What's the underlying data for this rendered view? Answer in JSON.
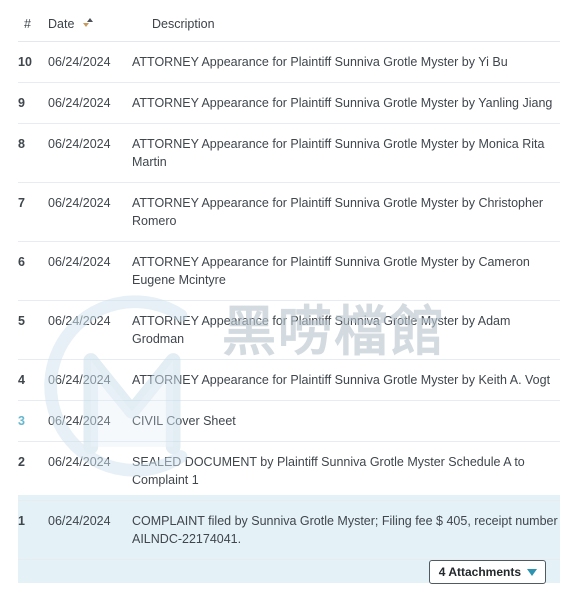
{
  "table": {
    "columns": [
      {
        "key": "num",
        "label": "#"
      },
      {
        "key": "date",
        "label": "Date",
        "sort_icon": "sort-ascending-icon"
      },
      {
        "key": "desc",
        "label": "Description"
      }
    ],
    "rows": [
      {
        "num": "10",
        "date": "06/24/2024",
        "desc": "ATTORNEY Appearance for Plaintiff Sunniva Grotle Myster by Yi Bu"
      },
      {
        "num": "9",
        "date": "06/24/2024",
        "desc": "ATTORNEY Appearance for Plaintiff Sunniva Grotle Myster by Yanling Jiang"
      },
      {
        "num": "8",
        "date": "06/24/2024",
        "desc": "ATTORNEY Appearance for Plaintiff Sunniva Grotle Myster by Monica Rita Martin"
      },
      {
        "num": "7",
        "date": "06/24/2024",
        "desc": "ATTORNEY Appearance for Plaintiff Sunniva Grotle Myster by Christopher Romero"
      },
      {
        "num": "6",
        "date": "06/24/2024",
        "desc": "ATTORNEY Appearance for Plaintiff Sunniva Grotle Myster by Cameron Eugene Mcintyre"
      },
      {
        "num": "5",
        "date": "06/24/2024",
        "desc": "ATTORNEY Appearance for Plaintiff Sunniva Grotle Myster by Adam Grodman"
      },
      {
        "num": "4",
        "date": "06/24/2024",
        "desc": "ATTORNEY Appearance for Plaintiff Sunniva Grotle Myster by Keith A. Vogt"
      },
      {
        "num": "3",
        "date": "06/24/2024",
        "desc": "CIVIL Cover Sheet"
      },
      {
        "num": "2",
        "date": "06/24/2024",
        "desc": "SEALED DOCUMENT by Plaintiff Sunniva Grotle Myster Schedule A to Complaint 1"
      },
      {
        "num": "1",
        "date": "06/24/2024",
        "desc": "COMPLAINT filed by Sunniva Grotle Myster; Filing fee $ 405, receipt number AILNDC-22174041."
      }
    ]
  },
  "attachments": {
    "label": "4 Attachments",
    "count": "4",
    "caret_icon": "chevron-down-icon"
  },
  "watermark": {
    "text": "黑唠檔館",
    "logo_icon": "cm-monogram-logo"
  },
  "colors": {
    "row_tint": "#e4f1f7",
    "row_plain": "#fafdfe",
    "row_number": "#d4702c",
    "row_number_alt": "#66b7cf",
    "text": "#3f464c",
    "border": "#e6edf1",
    "caret": "#2d93b0",
    "sort_down": "#c99a5e",
    "sort_up": "#4c5257",
    "watermark": "#b9c6cf"
  }
}
